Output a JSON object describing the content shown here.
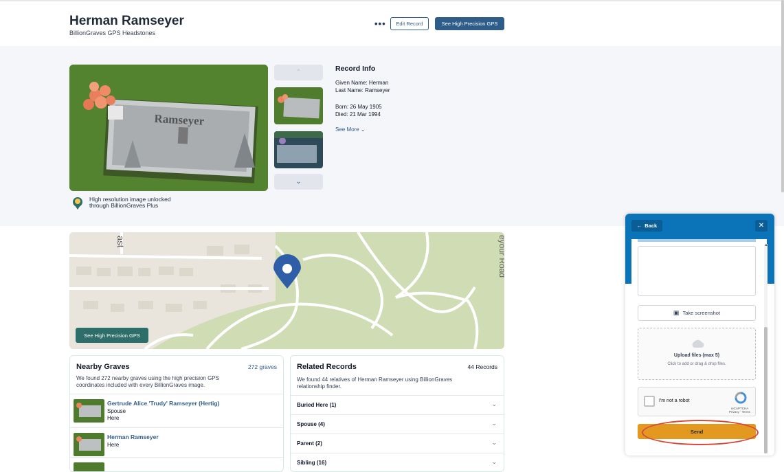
{
  "header": {
    "title": "Herman Ramseyer",
    "subtitle": "BillionGraves GPS Headstones",
    "more_label": "•••",
    "edit_label": "Edit Record",
    "gps_label": "See High Precision GPS"
  },
  "gallery": {
    "unlock_line1": "High resolution image unlocked",
    "unlock_line2": "through BillionGraves Plus"
  },
  "record": {
    "heading": "Record Info",
    "given": "Given Name: Herman",
    "last": "Last Name: Ramseyer",
    "born": "Born: 26 May 1905",
    "died": "Died: 21 Mar 1994",
    "see_more": "See More"
  },
  "map": {
    "gps_label": "See High Precision GPS",
    "road_label_1": "ast",
    "road_label_2": "eyour Road"
  },
  "nearby": {
    "title": "Nearby Graves",
    "count": "272 graves",
    "desc_line1": "We found 272 nearby graves using the high precision GPS",
    "desc_line2": "coordinates included with every BillionGraves image.",
    "rows": [
      {
        "name": "Gertrude Alice 'Trudy' Ramseyer (Hertig)",
        "line1": "Spouse",
        "line2": "Here"
      },
      {
        "name": "Herman Ramseyer",
        "line1": "Here"
      }
    ]
  },
  "related": {
    "title": "Related Records",
    "count": "44 Records",
    "desc_line1": "We found 44 relatives of Herman Ramseyer using BillionGraves",
    "desc_line2": "relationship finder.",
    "rows": [
      "Buried Here (1)",
      "Spouse (4)",
      "Parent (2)",
      "Sibling (16)"
    ]
  },
  "widget": {
    "back_label": "Back",
    "close_label": "✕",
    "screenshot_label": "Take screenshot",
    "upload_title": "Upload files (max 5)",
    "upload_sub": "Click to add or drag & drop files.",
    "captcha_label": "I'm not a robot",
    "captcha_brand": "reCAPTCHA",
    "captcha_links": "Privacy - Terms",
    "send_label": "Send"
  },
  "colors": {
    "primary": "#2f5d8a",
    "teal": "#2e6e6a",
    "widget_blue": "#0b73b8",
    "send": "#e3981f",
    "highlight": "#d9473a"
  }
}
